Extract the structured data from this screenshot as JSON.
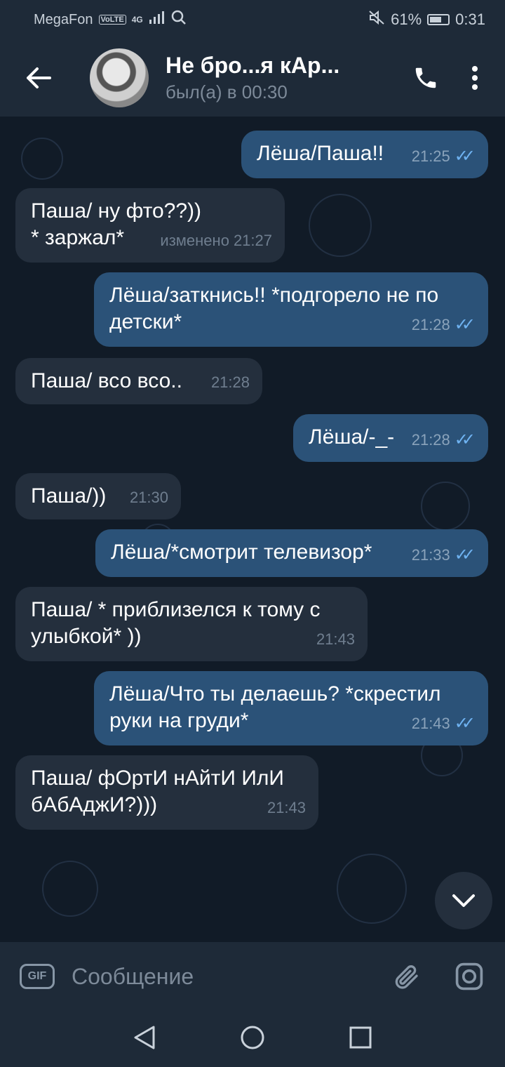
{
  "status_bar": {
    "carrier": "MegaFon",
    "volte": "VoLTE",
    "network": "4G",
    "battery": "61%",
    "time": "0:31"
  },
  "header": {
    "title": "Не бро...я кАр...",
    "status": "был(а) в 00:30"
  },
  "messages": [
    {
      "direction": "out",
      "text": "Лёша/Паша!!",
      "time": "21:25",
      "read": true
    },
    {
      "direction": "in",
      "text": "Паша/ ну фто??))\n* заржал*",
      "edited": "изменено",
      "time": "21:27"
    },
    {
      "direction": "out",
      "text": "Лёша/заткнись!! *подгорело не по\nдетски*",
      "time": "21:28",
      "read": true
    },
    {
      "direction": "in",
      "text": "Паша/ всо всо..",
      "time": "21:28"
    },
    {
      "direction": "out",
      "text": "Лёша/-_-",
      "time": "21:28",
      "read": true
    },
    {
      "direction": "in",
      "text": "Паша/))",
      "time": "21:30"
    },
    {
      "direction": "out",
      "text": "Лёша/*смотрит телевизор*",
      "time": "21:33",
      "read": true
    },
    {
      "direction": "in",
      "text": "Паша/ * приблизелся к тому с\nулыбкой* ))",
      "time": "21:43"
    },
    {
      "direction": "out",
      "text": "Лёша/Что ты делаешь? *скрестил\nруки на груди*",
      "time": "21:43",
      "read": true
    },
    {
      "direction": "in",
      "text": "Паша/ фОртИ нАйтИ ИлИ\nбАбАджИ?)))",
      "time": "21:43"
    }
  ],
  "input": {
    "gif_label": "GIF",
    "placeholder": "Сообщение"
  },
  "colors": {
    "outgoing_bubble": "#2b5278",
    "incoming_bubble": "#242f3d",
    "read_ticks": "#6fb3f2",
    "bars": "#1e2a38"
  }
}
